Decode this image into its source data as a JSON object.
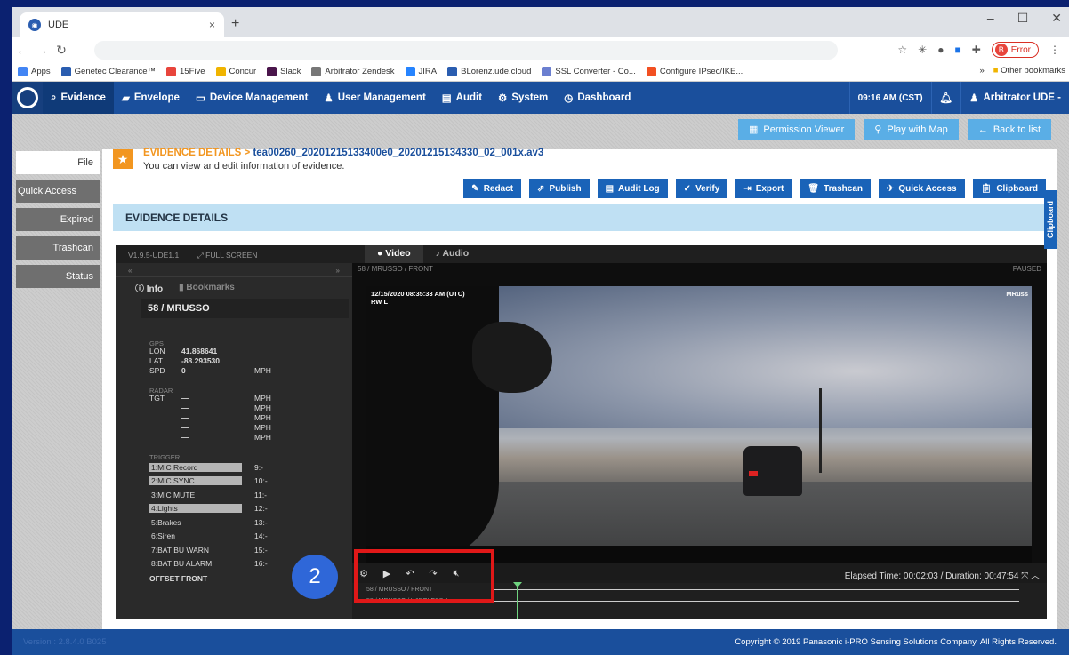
{
  "browser": {
    "tab_title": "UDE",
    "tab_close": "×",
    "new_tab": "+",
    "error_label": "Error",
    "error_badge": "B",
    "bookmarks": [
      {
        "label": "Apps",
        "color": "#4285f4"
      },
      {
        "label": "Genetec Clearance™",
        "color": "#2a5db0"
      },
      {
        "label": "15Five",
        "color": "#e8453c"
      },
      {
        "label": "Concur",
        "color": "#f0b400"
      },
      {
        "label": "Slack",
        "color": "#4a154b"
      },
      {
        "label": "Arbitrator Zendesk",
        "color": "#777777"
      },
      {
        "label": "JIRA",
        "color": "#2684ff"
      },
      {
        "label": "BLorenz.ude.cloud",
        "color": "#2a5db0"
      },
      {
        "label": "SSL Converter - Co...",
        "color": "#6b7fd0"
      },
      {
        "label": "Configure IPsec/IKE...",
        "color": "#f25022"
      }
    ],
    "more": "»",
    "other_bookmarks": "Other bookmarks"
  },
  "nav": {
    "items": [
      "Evidence",
      "Envelope",
      "Device Management",
      "User Management",
      "Audit",
      "System",
      "Dashboard"
    ],
    "time": "09:16 AM (CST)",
    "user": "Arbitrator UDE -"
  },
  "top_buttons": [
    "Permission Viewer",
    "Play with Map",
    "Back to list"
  ],
  "sidebar": [
    "File",
    "Quick Access",
    "Expired",
    "Trashcan",
    "Status"
  ],
  "header": {
    "crumb": "EVIDENCE DETAILS >",
    "filename": "tea00260_20201215133400e0_20201215134330_02_001x.av3",
    "subtitle": "You can view and edit information of evidence."
  },
  "actions": [
    "Redact",
    "Publish",
    "Audit Log",
    "Verify",
    "Export",
    "Trashcan",
    "Quick Access",
    "Clipboard"
  ],
  "section_title": "EVIDENCE DETAILS",
  "clipboard_tab": "Clipboard",
  "player": {
    "version": "V1.9.5-UDE1.1",
    "fullscreen": "FULL SCREEN",
    "tab_video": "Video",
    "tab_audio": "Audio",
    "info_tab": "Info",
    "bookmarks_tab": "Bookmarks",
    "unit": "58 / MRUSSO",
    "source": "58 / MRUSSO / FRONT",
    "state": "PAUSED",
    "gps_label": "GPS",
    "lon_k": "LON",
    "lon_v": "41.868641",
    "lat_k": "LAT",
    "lat_v": "-88.293530",
    "spd_k": "SPD",
    "spd_v": "0",
    "mph": "MPH",
    "radar_label": "RADAR",
    "tgt": "TGT",
    "dash": "—",
    "trigger_label": "TRIGGER",
    "triggers": [
      {
        "t": "1:MIC Record",
        "n": "9:-",
        "hl": true
      },
      {
        "t": "2:MIC SYNC",
        "n": "10:-",
        "hl": true
      },
      {
        "t": "3:MIC MUTE",
        "n": "11:-",
        "hl": false
      },
      {
        "t": "4:Lights",
        "n": "12:-",
        "hl": true
      },
      {
        "t": "5:Brakes",
        "n": "13:-",
        "hl": false
      },
      {
        "t": "6:Siren",
        "n": "14:-",
        "hl": false
      },
      {
        "t": "7:BAT BU WARN",
        "n": "15:-",
        "hl": false
      },
      {
        "t": "8:BAT BU ALARM",
        "n": "16:-",
        "hl": false
      }
    ],
    "offset": "OFFSET FRONT",
    "overlay_time": "12/15/2020 08:35:33 AM (UTC)",
    "overlay_rw": "RW L",
    "overlay_name": "MRuss",
    "elapsed": "Elapsed Time: 00:02:03 / Duration: 00:47:54",
    "track1": "58 / MRUSSO / FRONT",
    "track2": "58 / MRUSSO / WIRELESS 1",
    "playhead_fraction": 0.043
  },
  "callout_number": "2",
  "footer": {
    "version": "Version : 2.8.4.0 B025",
    "copyright": "Copyright © 2019 Panasonic i-PRO Sensing Solutions Company. All Rights Reserved."
  }
}
